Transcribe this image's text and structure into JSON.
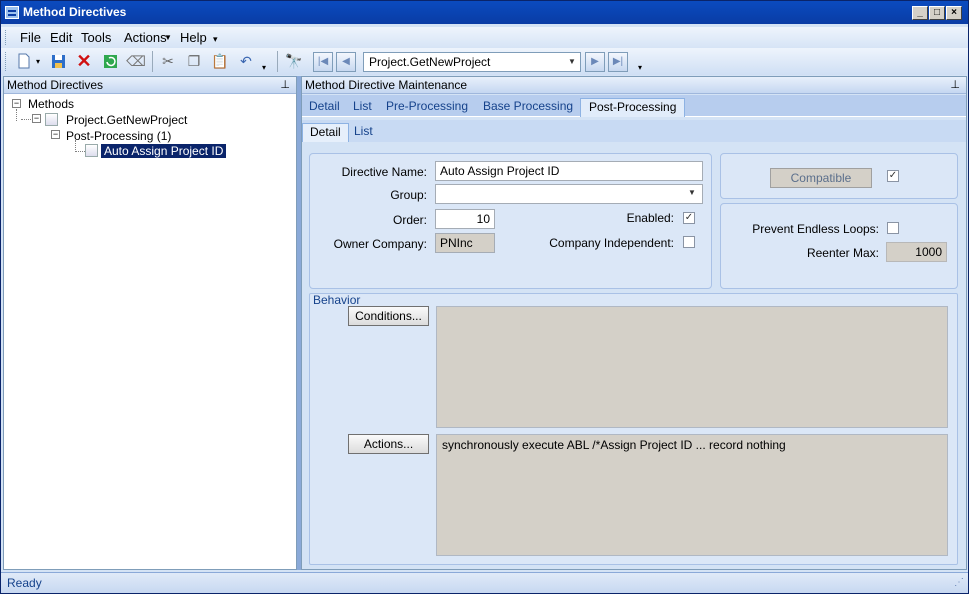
{
  "window": {
    "title": "Method Directives",
    "controls": [
      "_",
      "□",
      "×"
    ]
  },
  "menu": [
    "File",
    "Edit",
    "Tools",
    "Actions",
    "Help"
  ],
  "toolbar": {
    "method_combo": "Project.GetNewProject"
  },
  "left_panel": {
    "title": "Method Directives",
    "tree": {
      "root": "Methods",
      "method": "Project.GetNewProject",
      "stage": "Post-Processing (1)",
      "directive": "Auto Assign Project ID"
    }
  },
  "right_panel": {
    "title": "Method Directive Maintenance",
    "tabs": [
      "Detail",
      "List",
      "Pre-Processing",
      "Base Processing",
      "Post-Processing"
    ],
    "active_tab": "Post-Processing",
    "subtabs": [
      "Detail",
      "List"
    ],
    "active_subtab": "Detail"
  },
  "form": {
    "directive_name_label": "Directive Name:",
    "directive_name": "Auto Assign Project ID",
    "group_label": "Group:",
    "group": "",
    "order_label": "Order:",
    "order": "10",
    "owner_label": "Owner Company:",
    "owner": "PNInc",
    "enabled_label": "Enabled:",
    "enabled": true,
    "company_independent_label": "Company Independent:",
    "company_independent": false,
    "compatible_button": "Compatible",
    "compatible": true,
    "prevent_loops_label": "Prevent Endless Loops:",
    "prevent_loops": false,
    "reenter_label": "Reenter Max:",
    "reenter_max": "1000"
  },
  "behavior": {
    "title": "Behavior",
    "conditions_button": "Conditions...",
    "conditions_text": "",
    "actions_button": "Actions...",
    "actions_text": "synchronously execute ABL /*Assign Project ID ... record nothing"
  },
  "status": {
    "text": "Ready"
  }
}
